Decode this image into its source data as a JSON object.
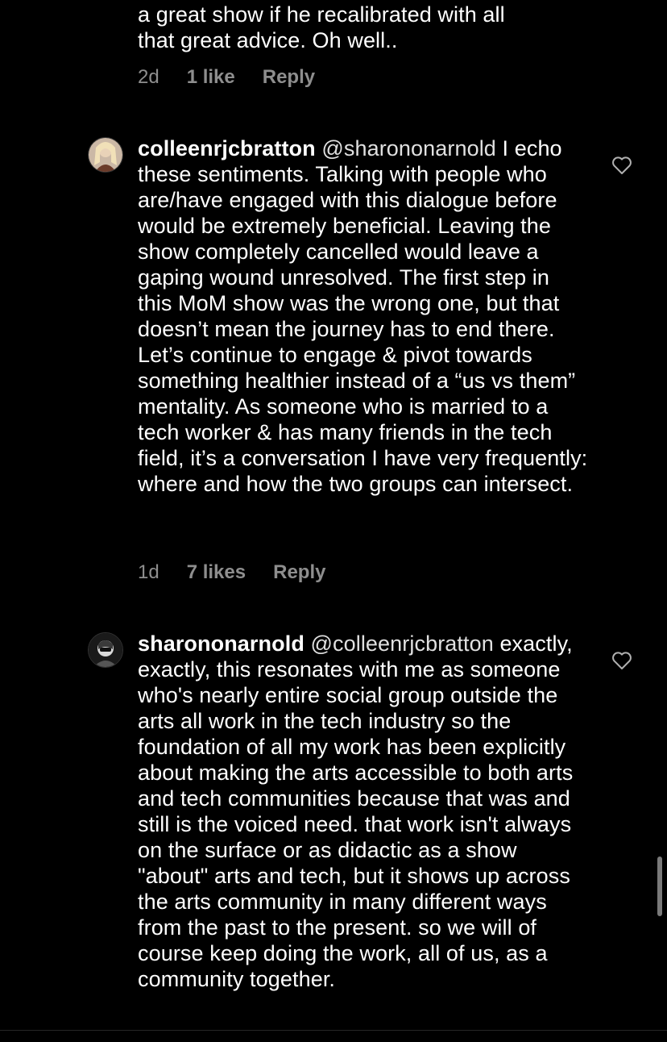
{
  "comments": [
    {
      "text_tail": "a great show if he recalibrated with all\nthat great advice. Oh well..",
      "time": "2d",
      "likes": "1 like",
      "reply": "Reply"
    },
    {
      "username": "colleenrjcbratton",
      "mention": "@sharononarnold",
      "text": " I echo these sentiments. Talking with people who are/have engaged with this dialogue before would be extremely beneficial. Leaving the show completely cancelled would leave a gaping wound unresolved. The first step in this MoM show was the wrong one, but that doesn’t mean the journey has to end there. Let’s continue to engage & pivot towards something healthier instead of a “us vs them” mentality. As someone who is married to a tech worker & has many friends in the tech field, it’s a conversation I have very frequently: where and how the two groups can intersect.",
      "time": "1d",
      "likes": "7 likes",
      "reply": "Reply",
      "avatar_icon": "user-avatar-photo",
      "like_icon": "heart-outline-icon"
    },
    {
      "username": "sharononarnold",
      "mention": "@colleenrjcbratton",
      "text": " exactly, exactly, this resonates with me as someone who's nearly entire social group outside the arts all work in the tech industry so the foundation of all my work has been explicitly about making the arts accessible to both arts and tech communities because that was and still is the voiced need. that work isn't always on the surface or as didactic as a show \"about\" arts and tech, but it shows up across the arts community in many different ways from the past to the present. so we will of course keep doing the work, all of us, as a community together.",
      "avatar_icon": "user-avatar-photo",
      "like_icon": "heart-outline-icon"
    }
  ],
  "colors": {
    "background": "#000000",
    "text": "#ffffff",
    "meta": "#8e8e8e"
  }
}
